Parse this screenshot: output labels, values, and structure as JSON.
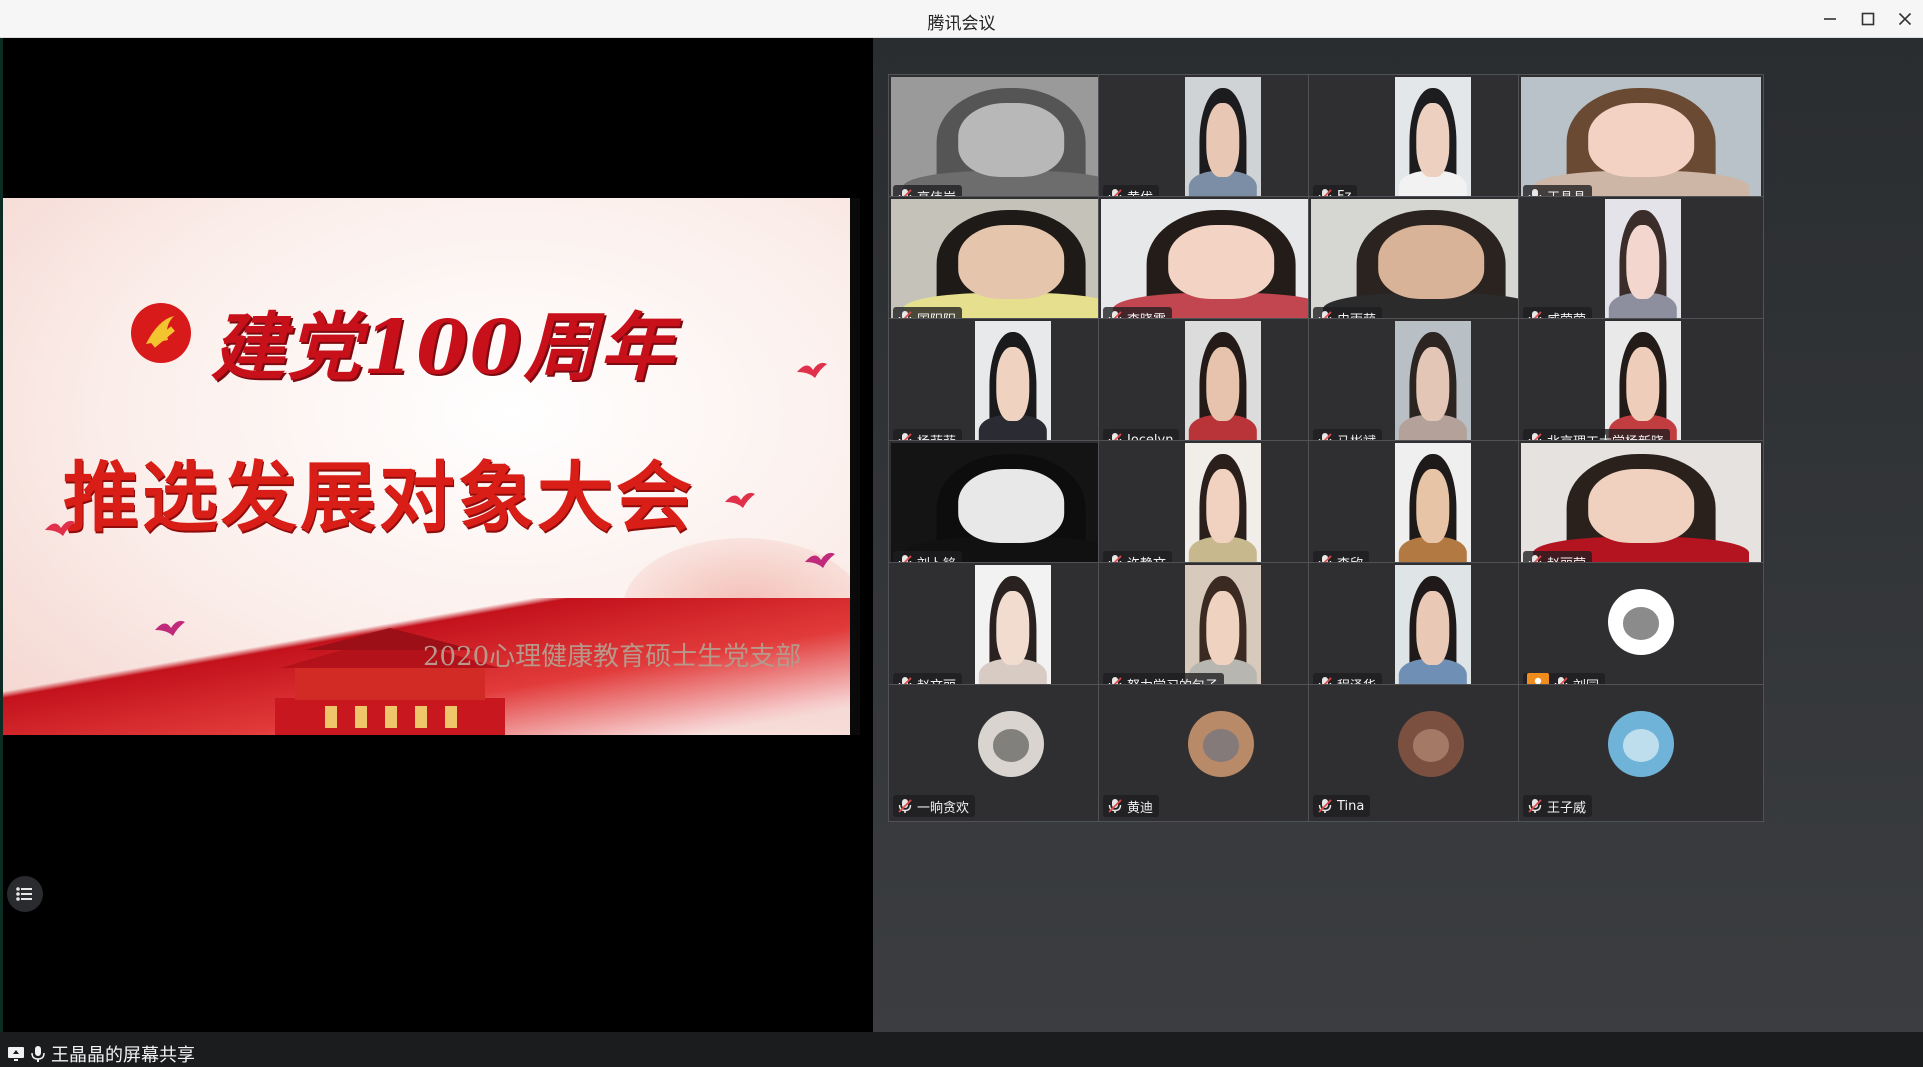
{
  "window": {
    "title": "腾讯会议"
  },
  "share": {
    "slide": {
      "heading1": "建党100周年",
      "heading2": "推选发展对象大会",
      "subtitle": "2020心理健康教育硕士生党支部"
    },
    "label": "王晶晶的屏幕共享"
  },
  "participants": [
    {
      "name": "高伟岸",
      "bg": "#9a9a9a",
      "skin": "#b8b8b8",
      "hair": "#555",
      "shirt": "#6d6d6d",
      "layout": "full",
      "muted": true
    },
    {
      "name": "黄优",
      "bg": "#cfd3d6",
      "skin": "#e8c7b4",
      "hair": "#1c1c1e",
      "shirt": "#7b8ea6",
      "layout": "half",
      "muted": true
    },
    {
      "name": "Fz",
      "bg": "#e3e7ea",
      "skin": "#edd0bf",
      "hair": "#1d1d1f",
      "shirt": "#f2f2f2",
      "layout": "half",
      "muted": true
    },
    {
      "name": "王晶晶",
      "bg": "#b9c2c8",
      "skin": "#f3d2c3",
      "hair": "#6a4a33",
      "shirt": "#cdb6a6",
      "layout": "full",
      "muted": false
    },
    {
      "name": "国阳阳",
      "bg": "#c5c2b9",
      "skin": "#e6c5ad",
      "hair": "#1e1a18",
      "shirt": "#e6e08e",
      "layout": "full",
      "muted": true
    },
    {
      "name": "李晓霞",
      "bg": "#e7e8ea",
      "skin": "#f2d3c4",
      "hair": "#241c19",
      "shirt": "#c2464f",
      "layout": "full",
      "muted": true
    },
    {
      "name": "史雨萌",
      "bg": "#d6d6d2",
      "skin": "#d9b397",
      "hair": "#2b2320",
      "shirt": "#2b2b2b",
      "layout": "full",
      "muted": true
    },
    {
      "name": "咸荣荣",
      "bg": "#e5e3ea",
      "skin": "#f3d7cf",
      "hair": "#3b2d2a",
      "shirt": "#8d8f9e",
      "layout": "half",
      "muted": true
    },
    {
      "name": "杨菲菲",
      "bg": "#e8e9ea",
      "skin": "#efd2c0",
      "hair": "#1a1a1c",
      "shirt": "#2b2b33",
      "layout": "half",
      "muted": true
    },
    {
      "name": "Jocelyn",
      "bg": "#dcdcdc",
      "skin": "#e7c3ad",
      "hair": "#241b18",
      "shirt": "#b83438",
      "layout": "half",
      "muted": true
    },
    {
      "name": "马彬斌",
      "bg": "#b8c0c6",
      "skin": "#e4c6b6",
      "hair": "#2d2522",
      "shirt": "#b4a29a",
      "layout": "half",
      "muted": true
    },
    {
      "name": "北京理工大学杨新晓",
      "bg": "#e9e9e9",
      "skin": "#efcdbb",
      "hair": "#231b18",
      "shirt": "#c23d40",
      "layout": "half",
      "muted": true
    },
    {
      "name": "刘卜铭",
      "bg": "#141414",
      "skin": "#e8e8e8",
      "hair": "#0d0d0d",
      "shirt": "#111111",
      "layout": "full",
      "muted": true
    },
    {
      "name": "许静文",
      "bg": "#f1eeea",
      "skin": "#f1d2c1",
      "hair": "#2b1f1b",
      "shirt": "#c7b98d",
      "layout": "half",
      "muted": true
    },
    {
      "name": "李欣",
      "bg": "#efefef",
      "skin": "#e8c4a6",
      "hair": "#1d1a19",
      "shirt": "#b27a42",
      "layout": "half",
      "muted": true
    },
    {
      "name": "赵丽莹",
      "bg": "#e5e2e0",
      "skin": "#f0d0bf",
      "hair": "#2a211d",
      "shirt": "#b3141f",
      "layout": "full",
      "muted": true
    },
    {
      "name": "赵文丽",
      "bg": "#f2f2f2",
      "skin": "#f1dccf",
      "hair": "#2a2220",
      "shirt": "#d8cbc4",
      "layout": "half",
      "muted": true
    },
    {
      "name": "努力学习的包子",
      "bg": "#d7cabd",
      "skin": "#f0d2c0",
      "hair": "#3a2a21",
      "shirt": "#b8b6b0",
      "layout": "half",
      "muted": true
    },
    {
      "name": "程泽华",
      "bg": "#dfe4e6",
      "skin": "#eac8b6",
      "hair": "#1f1a19",
      "shirt": "#6f8fb4",
      "layout": "half",
      "muted": true
    },
    {
      "name": "刘园",
      "avatar": "#ffffff",
      "accent": "#2b2b2b",
      "layout": "avatar",
      "muted": true,
      "host": true
    },
    {
      "name": "一晌贪欢",
      "avatar": "#d9d4cf",
      "accent": "#3a3a3a",
      "layout": "avatar",
      "muted": true
    },
    {
      "name": "黄迪",
      "avatar": "#b98a68",
      "accent": "#5a6e86",
      "layout": "avatar",
      "muted": true
    },
    {
      "name": "Tina",
      "avatar": "#7b5040",
      "accent": "#c69b85",
      "layout": "avatar",
      "muted": true
    },
    {
      "name": "王子威",
      "avatar": "#6fb4d8",
      "accent": "#ffffff",
      "layout": "avatar",
      "muted": true
    }
  ],
  "icons": {
    "mic_muted": "mic-muted-icon",
    "mic_on": "mic-icon",
    "host": "host-icon",
    "list": "list-icon",
    "screen_share": "screen-share-icon"
  },
  "colors": {
    "muted_red": "#e24b4b",
    "host_orange": "#f08b1e"
  }
}
